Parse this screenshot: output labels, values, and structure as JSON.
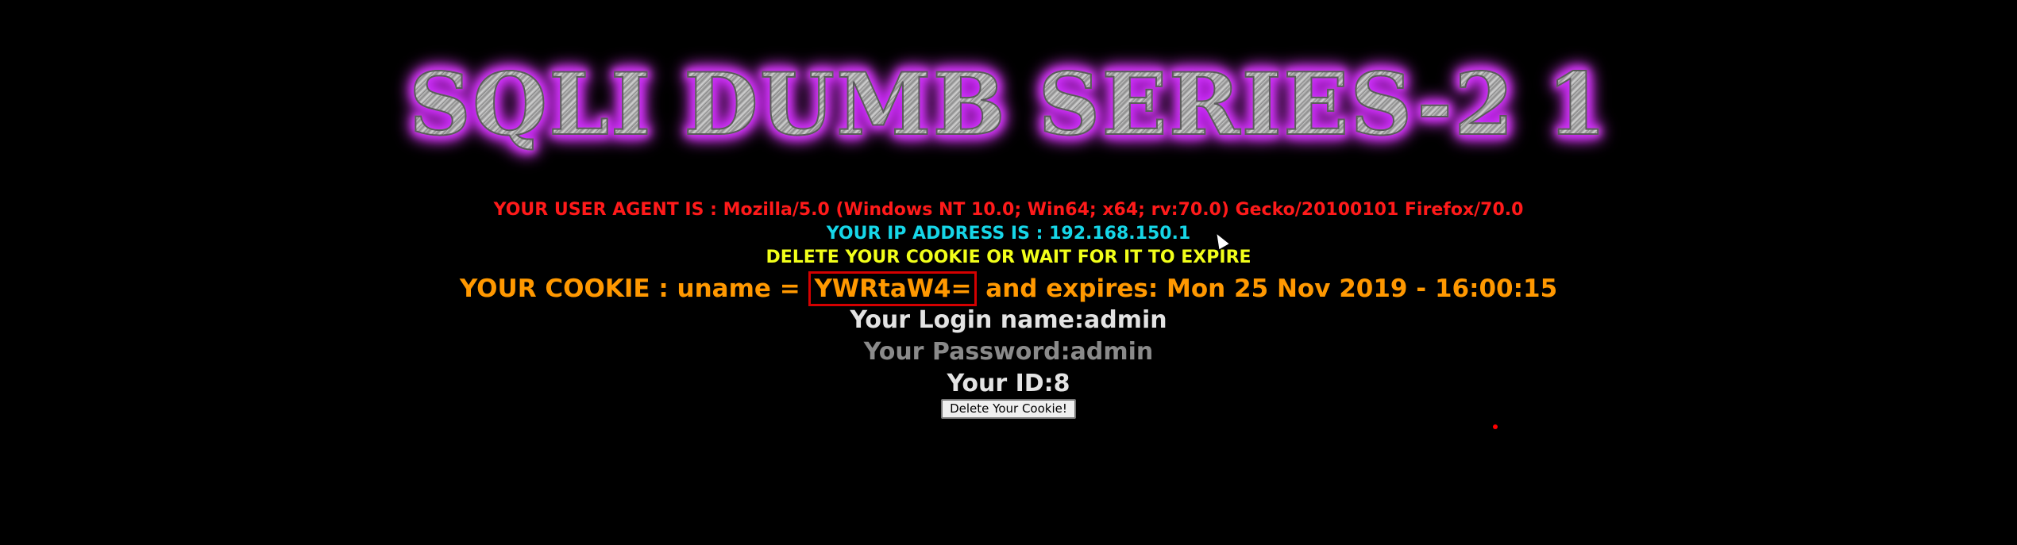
{
  "title": "SQLI DUMB SERIES-2 1",
  "user_agent_label": "YOUR USER AGENT IS : ",
  "user_agent_value": "Mozilla/5.0 (Windows NT 10.0; Win64; x64; rv:70.0) Gecko/20100101 Firefox/70.0",
  "ip_label": "YOUR IP ADDRESS IS : ",
  "ip_value": "192.168.150.1",
  "delete_notice": "DELETE YOUR COOKIE OR WAIT FOR IT TO EXPIRE",
  "cookie": {
    "prefix": "YOUR COOKIE : uname = ",
    "value": "YWRtaW4=",
    "suffix": " and expires: Mon 25 Nov 2019 - 16:00:15"
  },
  "login_name": "Your Login name:admin",
  "password": "Your Password:admin",
  "id": "Your ID:8",
  "delete_button_label": "Delete Your Cookie!",
  "colors": {
    "background": "#000000",
    "user_agent": "#ff1a1a",
    "ip": "#16d6e8",
    "notice": "#f2ff1a",
    "cookie": "#ff9800",
    "cookie_highlight_border": "#d40000",
    "login": "#e3e3e3",
    "password": "#8a8a8a",
    "title_glow": "#d23cff"
  },
  "icons": {
    "cursor": "mouse-pointer-icon"
  }
}
